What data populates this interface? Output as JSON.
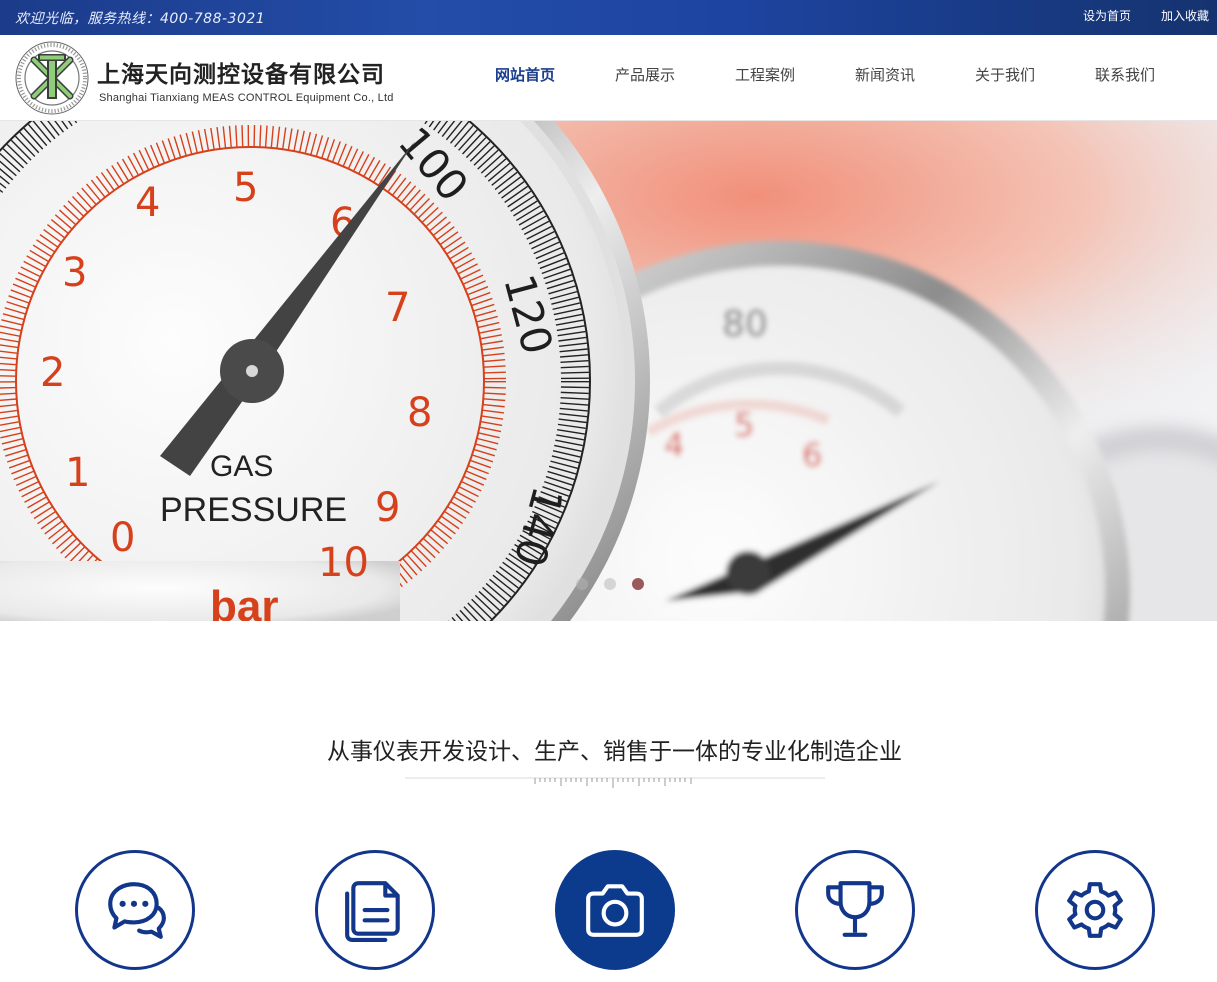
{
  "topbar": {
    "welcome": "欢迎光临，服务热线：400-788-3021",
    "set_home": "设为首页",
    "add_favorite": "加入收藏"
  },
  "header": {
    "company_cn": "上海天向测控设备有限公司",
    "company_en": "Shanghai Tianxiang MEAS CONTROL Equipment Co., Ltd"
  },
  "nav": {
    "items": [
      {
        "label": "网站首页",
        "active": true
      },
      {
        "label": "产品展示"
      },
      {
        "label": "工程案例"
      },
      {
        "label": "新闻资讯"
      },
      {
        "label": "关于我们"
      },
      {
        "label": "联系我们"
      }
    ]
  },
  "banner": {
    "gauge_label_1": "GAS",
    "gauge_label_2": "PRESSURE",
    "unit": "bar",
    "inner_numbers": [
      "0",
      "1",
      "2",
      "3",
      "4",
      "5",
      "6",
      "7",
      "8",
      "9",
      "10"
    ],
    "outer_numbers": [
      "100",
      "120",
      "140"
    ],
    "back_gauge_number": "80",
    "back_gauge_inner": [
      "4",
      "5",
      "6"
    ],
    "dots": 3,
    "active_dot": 3
  },
  "section": {
    "slogan": "从事仪表开发设计、生产、销售于一体的专业化制造企业"
  },
  "features": [
    {
      "icon": "chat-icon"
    },
    {
      "icon": "document-icon"
    },
    {
      "icon": "camera-icon"
    },
    {
      "icon": "trophy-icon"
    },
    {
      "icon": "gear-icon"
    }
  ],
  "colors": {
    "brand_blue": "#12378a",
    "topbar_blue": "#234da8",
    "gauge_red": "#d6401b"
  }
}
